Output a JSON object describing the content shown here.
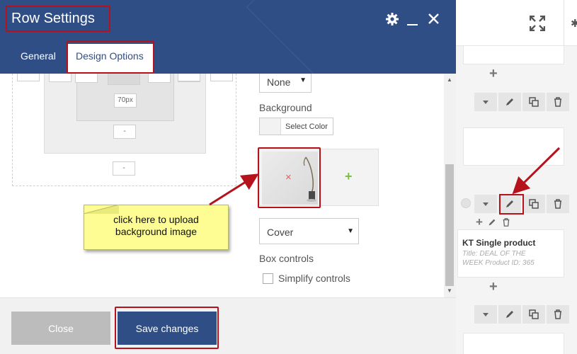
{
  "modal": {
    "title": "Row Settings",
    "tabs": [
      {
        "label": "General",
        "active": false
      },
      {
        "label": "Design Options",
        "active": true
      }
    ],
    "header_icons": [
      "gear-icon",
      "minimize-icon",
      "close-icon"
    ],
    "accent_color": "#2e4e85",
    "highlight_color": "#b5121b"
  },
  "spacing": {
    "size_value": "70px",
    "dash": "-"
  },
  "design": {
    "border_style_value": "None",
    "background_label": "Background",
    "select_color_label": "Select Color",
    "background_size_value": "Cover",
    "box_controls_label": "Box controls",
    "simplify_controls_label": "Simplify controls",
    "simplify_checked": false,
    "remove_symbol": "×",
    "add_symbol": "+"
  },
  "callout": {
    "text_line1": "click here to upload",
    "text_line2": "background image"
  },
  "footer": {
    "close_label": "Close",
    "save_label": "Save changes"
  },
  "builder": {
    "element_title": "KT Single product",
    "element_meta_line1": "Title: DEAL OF THE",
    "element_meta_line2": "WEEK  Product ID: 365",
    "add_symbol": "+"
  }
}
